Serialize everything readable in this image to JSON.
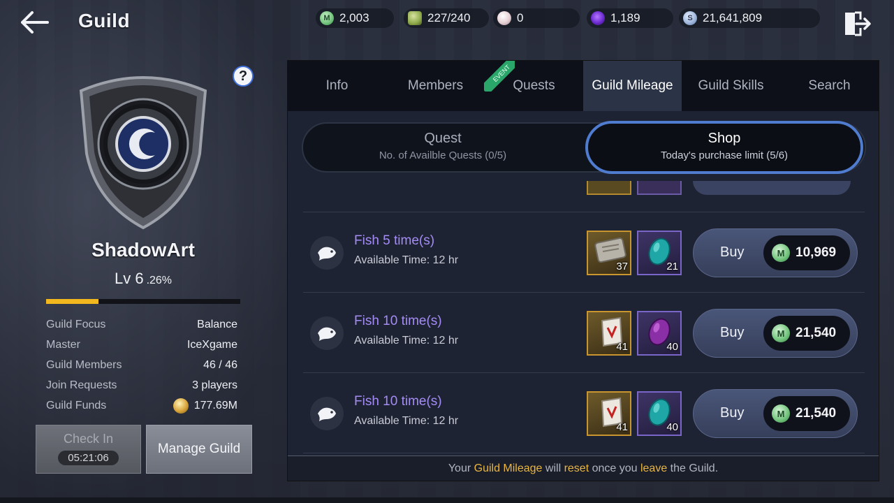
{
  "header": {
    "title": "Guild",
    "resources": [
      {
        "icon": "mileage-coin-icon",
        "value": "2,003"
      },
      {
        "icon": "stamina-icon",
        "value": "227/240"
      },
      {
        "icon": "pearl-icon",
        "value": "0"
      },
      {
        "icon": "darksteel-icon",
        "value": "1,189"
      },
      {
        "icon": "silver-coin-icon",
        "value": "21,641,809"
      }
    ]
  },
  "guild": {
    "name": "ShadowArt",
    "level": "Lv 6",
    "level_percent": ".26%",
    "xp_progress": 0.27,
    "info": [
      {
        "label": "Guild Focus",
        "value": "Balance"
      },
      {
        "label": "Master",
        "value": "IceXgame"
      },
      {
        "label": "Guild Members",
        "value": "46 / 46"
      },
      {
        "label": "Join Requests",
        "value": "3 players"
      },
      {
        "label": "Guild Funds",
        "value": "177.69M"
      }
    ],
    "checkin_label": "Check In",
    "checkin_timer": "05:21:06",
    "manage_label": "Manage Guild"
  },
  "tabs": [
    {
      "label": "Info"
    },
    {
      "label": "Members"
    },
    {
      "label": "Quests",
      "badge": "EVENT"
    },
    {
      "label": "Guild Mileage",
      "active": true
    },
    {
      "label": "Guild Skills"
    },
    {
      "label": "Search"
    }
  ],
  "subtabs": {
    "quest": {
      "title": "Quest",
      "subtitle": "No. of Availble Quests (0/5)"
    },
    "shop": {
      "title": "Shop",
      "subtitle": "Today's purchase limit (5/6)"
    }
  },
  "shop_items": [
    {
      "name": "Fish 5 time(s)",
      "time": "Available Time: 12 hr",
      "reward1_qty": "37",
      "reward1_icon": "tablet-icon",
      "reward2_qty": "21",
      "reward2_icon": "teal-gem-icon",
      "buy_label": "Buy",
      "price": "10,969"
    },
    {
      "name": "Fish 10 time(s)",
      "time": "Available Time: 12 hr",
      "reward1_qty": "41",
      "reward1_icon": "scroll-icon",
      "reward2_qty": "40",
      "reward2_icon": "purple-gem-icon",
      "buy_label": "Buy",
      "price": "21,540"
    },
    {
      "name": "Fish 10 time(s)",
      "time": "Available Time: 12 hr",
      "reward1_qty": "41",
      "reward1_icon": "scroll-icon",
      "reward2_qty": "40",
      "reward2_icon": "teal-gem-icon",
      "buy_label": "Buy",
      "price": "21,540"
    }
  ],
  "footer": {
    "p1": "Your ",
    "h1": "Guild Mileage",
    "p2": " will ",
    "h2": "reset",
    "p3": " once you ",
    "h3": "leave",
    "p4": " the Guild."
  },
  "colors": {
    "accent_purple": "#a48cf5",
    "highlight_gold": "#e9b640",
    "active_tab": "#2b3346",
    "shop_border": "#4f7ccf",
    "xp_fill": "#f2b81e"
  }
}
